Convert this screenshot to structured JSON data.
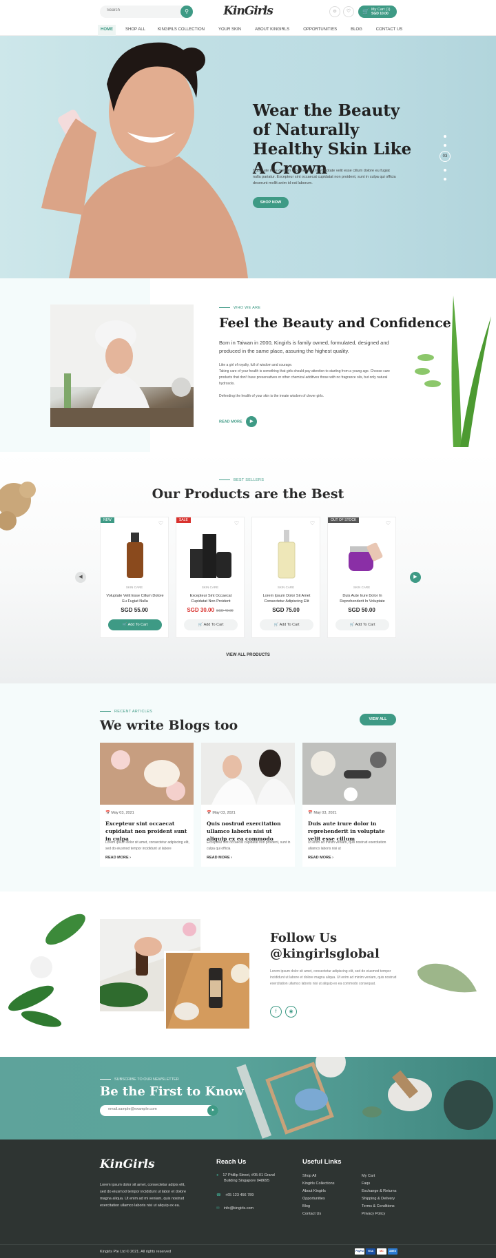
{
  "header": {
    "search_placeholder": "Search",
    "logo_text": "KinGirls",
    "cart_label": "My Cart (1)",
    "cart_total": "SGD 10.00",
    "nav": [
      "HOME",
      "SHOP ALL",
      "KINGIRLS COLLECTION",
      "YOUR SKIN",
      "ABOUT KINGIRLS",
      "OPPORTUNITIES",
      "BLOG",
      "CONTACT US"
    ]
  },
  "hero": {
    "title": "Wear the Beauty of Naturally Healthy Skin Like A Crown",
    "text": "Duis aute irure dolor in reprehenderit in voluptate velit esse cillum dolore eu fugiat nulla pariatur. Excepteur sint occaecat cupidatat non proident, sunt in culpa qui officia deserunt mollit anim id est laborum.",
    "button": "SHOP NOW",
    "slide_number": "03"
  },
  "about": {
    "eyebrow": "WHO WE ARE",
    "title": "Feel the Beauty and Confidence",
    "lead": "Born in Taiwan in 2000, Kingirls is family owned, formulated, designed and produced in the same place, assuring the highest quality.",
    "body1": "Like a girl of royalty, full of wisdom and courage.",
    "body2": "Taking care of your health is something that girls should pay attention to starting from a young age. Choose care products that don't have preservatives or other chemical additives those with no fragrance oils, but only natural hydrosols.",
    "body3": "Defending the health of your skin is the innate wisdom of clever girls.",
    "read_more": "READ MORE"
  },
  "products": {
    "eyebrow": "BEST SELLERS",
    "title": "Our Products are the Best",
    "view_all": "VIEW ALL PRODUCTS",
    "items": [
      {
        "badge": "NEW",
        "badge_color": "#3e9a85",
        "category": "SKIN CARE",
        "name": "Voluptate Velit Esse Cillum Dolore Eu Fugiat Nulla",
        "price": "SGD 55.00",
        "old_price": "",
        "button": "Add To Cart"
      },
      {
        "badge": "SALE",
        "badge_color": "#d9322e",
        "category": "SKIN CARE",
        "name": "Excepteur Sint Occaecat Cupidatat Non Proident",
        "price": "SGD 30.00",
        "old_price": "SGD 40.00",
        "button": "Add To Cart"
      },
      {
        "badge": "",
        "badge_color": "",
        "category": "SKIN CARE",
        "name": "Lorem Ipsum Dolor Sit Amet Consectetur Adipiscing Elit",
        "price": "SGD 75.00",
        "old_price": "",
        "button": "Add To Cart"
      },
      {
        "badge": "OUT OF STOCK",
        "badge_color": "#555555",
        "category": "SKIN CARE",
        "name": "Duis Aute Irure Dolor In Reprehenderit In Voluptate",
        "price": "SGD 50.00",
        "old_price": "",
        "button": "Add To Cart"
      }
    ]
  },
  "blog": {
    "eyebrow": "RECENT ARTICLES",
    "title": "We write Blogs too",
    "view_all": "VIEW ALL",
    "items": [
      {
        "date": "May 03, 2021",
        "title": "Excepteur sint occaecat cupidatat non proident sunt in culpa",
        "excerpt": "Lorem ipsum dolor sit amet, consectetur adipiscing elit, sed do eiusmod tempor incididunt ut labore",
        "read_more": "READ MORE"
      },
      {
        "date": "May 03, 2021",
        "title": "Quis nostrud exercitation ullamco laboris nisi ut aliquip ex ea commodo",
        "excerpt": "Excepteur sint occaecat cupidatat non proident, sunt in culpa qui officia",
        "read_more": "READ MORE"
      },
      {
        "date": "May 03, 2021",
        "title": "Duis aute irure dolor in reprehenderit in voluptate velit esse cillum",
        "excerpt": "Ut enim ad minim veniam, quis nostrud exercitation ullamco laboris nisi ut",
        "read_more": "READ MORE"
      }
    ]
  },
  "follow": {
    "title": "Follow Us @kingirlsglobal",
    "text": "Lorem ipsum dolor sit amet, consectetur adipiscing elit, sed do eiusmod tempor incididunt ut labore et dolore magna aliqua. Ut enim ad minim veniam, quis nostrud exercitation ullamco laboris nisi ut aliquip ex ea commodo consequat."
  },
  "subscribe": {
    "eyebrow": "SUBSCRIBE TO OUR NEWSLETTER",
    "title": "Be the First to Know",
    "placeholder": "email.sample@example.com"
  },
  "footer": {
    "logo_text": "KinGirls",
    "about": "Lorem ipsum dolor sit amet, consectetur adipis elit, sed do eiusmod tempor incididunt ut labor et dolore magna aliqua. Ut enim ad mi veniam, quis nostrud exercitation ullamco laboris nisi ut aliquip ex ea.",
    "reach_title": "Reach Us",
    "address_line1": "17 Phillip Street, #05-01 Grand",
    "address_line2": "Building Singapore 048695",
    "phone": "+65 123 456 789",
    "email": "info@kingirls.com",
    "links_title": "Useful Links",
    "links_col1": [
      "Shop All",
      "Kingirls Collections",
      "About Kingirls",
      "Opportunities",
      "Blog",
      "Contact Us"
    ],
    "links_col2": [
      "My Cart",
      "Faqs",
      "Exchange & Returns",
      "Shipping & Delivery",
      "Terms & Conditions",
      "Privacy Policy"
    ],
    "copyright": "Kingirls Pte Ltd © 2021. All rights reserved",
    "payments": [
      "PayPal",
      "VISA",
      "MC",
      "AMEX"
    ]
  },
  "colors": {
    "accent": "#3e9a85",
    "dark": "#2e3432",
    "sale": "#d9322e"
  }
}
